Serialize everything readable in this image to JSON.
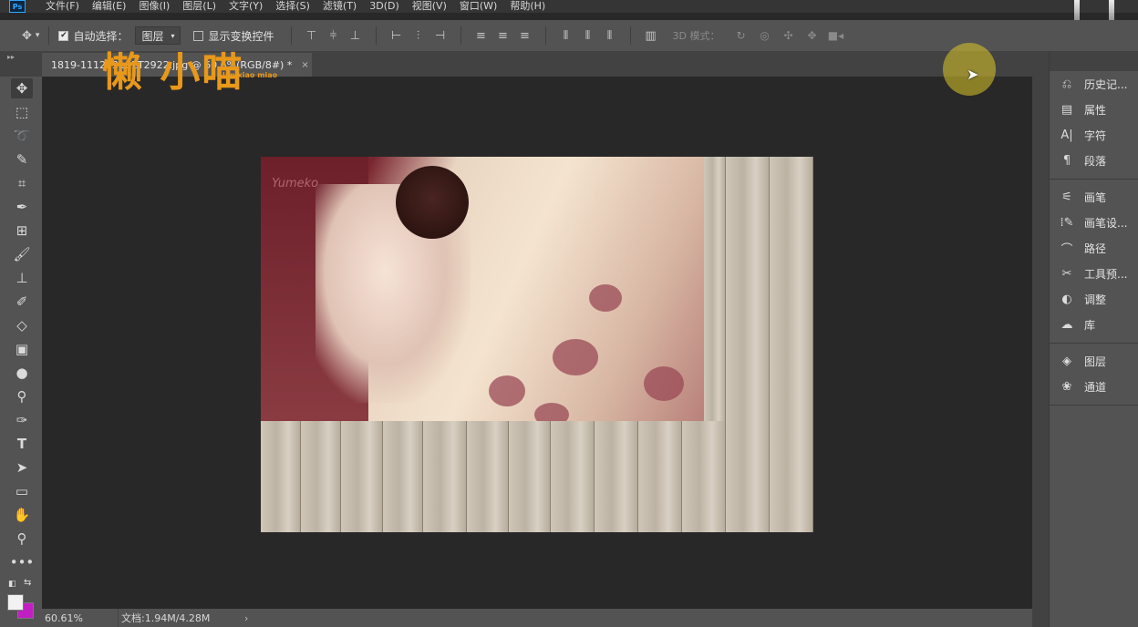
{
  "app": {
    "logo": "Ps",
    "menu": [
      "文件(F)",
      "编辑(E)",
      "图像(I)",
      "图层(L)",
      "文字(Y)",
      "选择(S)",
      "滤镜(T)",
      "3D(D)",
      "视图(V)",
      "窗口(W)",
      "帮助(H)"
    ]
  },
  "options": {
    "auto_select_label": "自动选择：",
    "auto_select_checked": true,
    "layer_select_value": "图层",
    "show_transform_label": "显示变换控件",
    "show_transform_checked": false,
    "mode_3d_label": "3D 模式："
  },
  "document": {
    "tab_title": "1819-111203162T2922.jpg @ 60.6%(RGB/8#) *",
    "close_glyph": "×",
    "photo_watermark": "Yumeko"
  },
  "watermark": {
    "logo_text": "懒 小喵",
    "logo_subtext": "lan xiao miao"
  },
  "status": {
    "zoom": "60.61%",
    "doc_info": "文档:1.94M/4.28M",
    "more_glyph": "›"
  },
  "panels": [
    {
      "label": "历史记...",
      "icon": "history-icon"
    },
    {
      "label": "属性",
      "icon": "properties-icon"
    },
    {
      "label": "字符",
      "icon": "character-icon"
    },
    {
      "label": "段落",
      "icon": "paragraph-icon"
    },
    {
      "label": "画笔",
      "icon": "brush-icon"
    },
    {
      "label": "画笔设...",
      "icon": "brush-settings-icon"
    },
    {
      "label": "路径",
      "icon": "paths-icon"
    },
    {
      "label": "工具预...",
      "icon": "tool-presets-icon"
    },
    {
      "label": "调整",
      "icon": "adjustments-icon"
    },
    {
      "label": "库",
      "icon": "libraries-icon"
    },
    {
      "label": "图层",
      "icon": "layers-icon"
    },
    {
      "label": "通道",
      "icon": "channels-icon"
    }
  ],
  "colors": {
    "foreground": "#f2f2f2",
    "background": "#c21fc2",
    "logo_orange": "#e8981a"
  }
}
